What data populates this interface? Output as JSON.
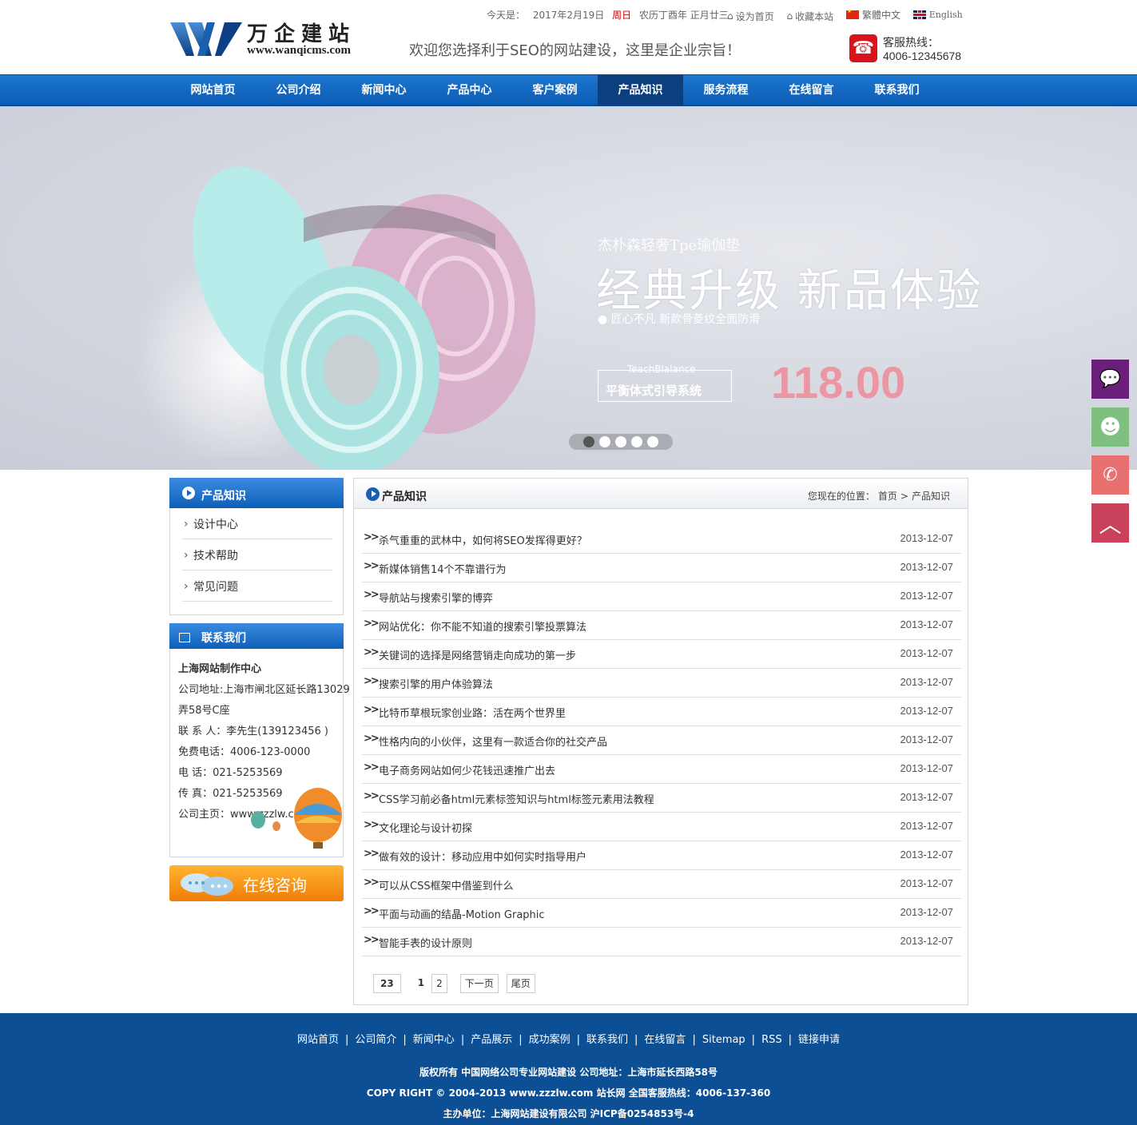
{
  "header": {
    "logo_cn": "万企建站",
    "logo_url": "www.wanqicms.com",
    "slogan": "欢迎您选择利于SEO的网站建设，这里是企业宗旨！",
    "today_label": "今天是：",
    "date": "2017年2月19日",
    "weekday": "周日",
    "lunar": "农历丁酉年  正月廿三",
    "set_home": "设为首页",
    "bookmark": "收藏本站",
    "traditional": "繁體中文",
    "english": "English",
    "hotline_label": "客服热线：",
    "hotline_number": "4006-12345678"
  },
  "nav": {
    "items": [
      "网站首页",
      "公司介绍",
      "新闻中心",
      "产品中心",
      "客户案例",
      "产品知识",
      "服务流程",
      "在线留言",
      "联系我们"
    ],
    "active_index": 5
  },
  "banner": {
    "subtitle": "杰朴森轻奢Tpe瑜伽垫",
    "title": "经典升级 新品体验",
    "line": "● 匠心不凡 新款骨菱纹全面防滑",
    "box_top": "TeachBlalance",
    "box_main": "平衡体式引导系统",
    "price": "118.00",
    "dots": 5,
    "active_dot": 0
  },
  "sidebar": {
    "category_title": "产品知识",
    "categories": [
      "设计中心",
      "技术帮助",
      "常见问题"
    ],
    "contact_title": "联系我们",
    "contact": {
      "company": "上海网站制作中心",
      "address1": "公司地址:上海市闸北区延长路13029",
      "address2": "弄58号C座",
      "person": "联 系 人：李先生(139123456 )",
      "free_phone": "免费电话：4006-123-0000",
      "phone": "电 话：021-5253569",
      "fax": "传 真：021-5253569",
      "homepage": "公司主页：www.zzzlw.com"
    },
    "consult_label": "在线咨询"
  },
  "main": {
    "title": "产品知识",
    "crumb_label": "您现在的位置：",
    "crumb_home": "首页",
    "crumb_sep": ">",
    "crumb_current": "产品知识",
    "articles": [
      {
        "title": "杀气重重的武林中，如何将SEO发挥得更好？",
        "date": "2013-12-07"
      },
      {
        "title": "新媒体销售14个不靠谱行为",
        "date": "2013-12-07"
      },
      {
        "title": "导航站与搜索引擎的博弈",
        "date": "2013-12-07"
      },
      {
        "title": "网站优化：你不能不知道的搜索引擎投票算法",
        "date": "2013-12-07"
      },
      {
        "title": "关键词的选择是网络营销走向成功的第一步",
        "date": "2013-12-07"
      },
      {
        "title": "搜索引擎的用户体验算法",
        "date": "2013-12-07"
      },
      {
        "title": "比特币草根玩家创业路：活在两个世界里",
        "date": "2013-12-07"
      },
      {
        "title": "性格内向的小伙伴，这里有一款适合你的社交产品",
        "date": "2013-12-07"
      },
      {
        "title": "电子商务网站如何少花钱迅速推广出去",
        "date": "2013-12-07"
      },
      {
        "title": "CSS学习前必备html元素标签知识与html标签元素用法教程",
        "date": "2013-12-07"
      },
      {
        "title": "文化理论与设计初探",
        "date": "2013-12-07"
      },
      {
        "title": "做有效的设计：移动应用中如何实时指导用户",
        "date": "2013-12-07"
      },
      {
        "title": "可以从CSS框架中借鉴到什么",
        "date": "2013-12-07"
      },
      {
        "title": "平面与动画的结晶-Motion Graphic",
        "date": "2013-12-07"
      },
      {
        "title": "智能手表的设计原则",
        "date": "2013-12-07"
      }
    ],
    "pager": {
      "total": "23",
      "current": "1",
      "page2": "2",
      "next": "下一页",
      "last": "尾页"
    }
  },
  "footer": {
    "links": [
      "网站首页",
      "公司简介",
      "新闻中心",
      "产品展示",
      "成功案例",
      "联系我们",
      "在线留言",
      "Sitemap",
      "RSS",
      "链接申请"
    ],
    "line1": "版权所有 中国网络公司专业网站建设 公司地址：上海市延长西路58号",
    "line2": "COPY RIGHT © 2004-2013 www.zzzlw.com 站长网 全国客服热线：4006-137-360",
    "line3": "主办单位：上海网站建设有限公司 沪ICP备0254853号-4"
  },
  "float": {
    "wechat_color": "#6a1f7a",
    "qq_color": "#7fbf7f",
    "phone_color": "#e87070",
    "top_color": "#c9415a"
  }
}
